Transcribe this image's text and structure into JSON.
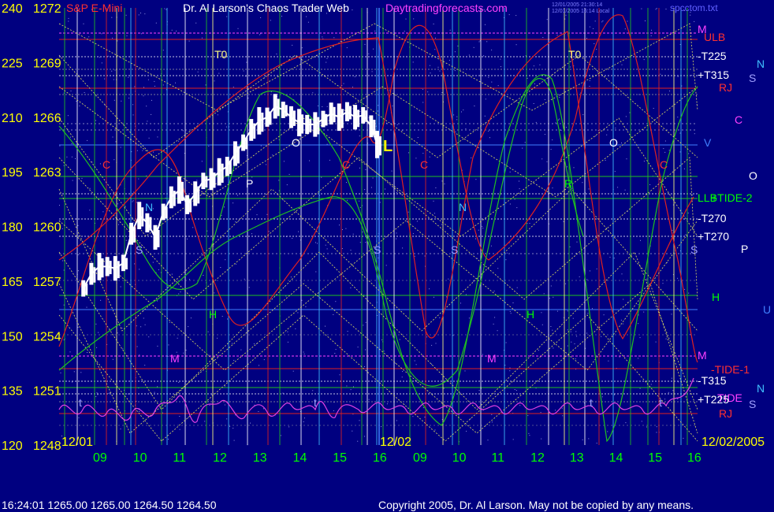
{
  "header": {
    "symbol": "S&P E-Mini",
    "title": "Dr. Al Larson's Chaos Trader Web",
    "site": "Daytradingforecasts.com",
    "stamp_line1": "12/01/2005 21:30:14",
    "stamp_line2": "12/01/2005 16:14 Local",
    "file": "spcctom.txt"
  },
  "footer": {
    "quote": "16:24:01  1265.00  1265.00  1264.50  1264.50",
    "copyright": "Copyright 2005, Dr. Al Larson. May not be copied by any means."
  },
  "left_axis": [
    {
      "deg": "240",
      "price": "1272"
    },
    {
      "deg": "225",
      "price": "1269"
    },
    {
      "deg": "210",
      "price": "1266"
    },
    {
      "deg": "195",
      "price": "1263"
    },
    {
      "deg": "180",
      "price": "1260"
    },
    {
      "deg": "165",
      "price": "1257"
    },
    {
      "deg": "150",
      "price": "1254"
    },
    {
      "deg": "135",
      "price": "1251"
    },
    {
      "deg": "120",
      "price": "1248"
    }
  ],
  "x_axis": {
    "day1_label": "12/01",
    "day2_label": "12/02",
    "end_label": "12/02/2005",
    "hours_day1": [
      "09",
      "10",
      "11",
      "12",
      "13",
      "14",
      "15",
      "16"
    ],
    "hours_day2": [
      "09",
      "10",
      "11",
      "12",
      "13",
      "14",
      "15",
      "16"
    ]
  },
  "right_labels": [
    {
      "text": "M",
      "color": "#ff40ff"
    },
    {
      "text": "ULB",
      "color": "#ff3030"
    },
    {
      "text": "-T225",
      "color": "#ffffff"
    },
    {
      "text": "N",
      "color": "#40c0ff"
    },
    {
      "text": "+T315",
      "color": "#ffffff"
    },
    {
      "text": "S",
      "color": "#a0a0ff"
    },
    {
      "text": "RJ",
      "color": "#ff3030"
    },
    {
      "text": "C",
      "color": "#ff40ff"
    },
    {
      "text": "V",
      "color": "#4080ff"
    },
    {
      "text": "O",
      "color": "#ffffff"
    },
    {
      "text": "LLB",
      "color": "#00ff00"
    },
    {
      "text": "+TIDE-2",
      "color": "#00ff00"
    },
    {
      "text": "-T270",
      "color": "#ffffff"
    },
    {
      "text": "+T270",
      "color": "#ffffff"
    },
    {
      "text": "P",
      "color": "#ffffff"
    },
    {
      "text": "H",
      "color": "#00ff00"
    },
    {
      "text": "U",
      "color": "#4080ff"
    },
    {
      "text": "M",
      "color": "#ff40ff"
    },
    {
      "text": "-TIDE-1",
      "color": "#ff3030"
    },
    {
      "text": "-T315",
      "color": "#ffffff"
    },
    {
      "text": "N",
      "color": "#40c0ff"
    },
    {
      "text": "TIDE",
      "color": "#ff40ff"
    },
    {
      "text": "+T225",
      "color": "#ffffff"
    },
    {
      "text": "S",
      "color": "#a0a0ff"
    },
    {
      "text": "RJ",
      "color": "#ff3030"
    }
  ],
  "chart_labels": [
    {
      "text": "T0",
      "color": "#ffff80"
    },
    {
      "text": "T0",
      "color": "#ffff80"
    },
    {
      "text": "C",
      "color": "#ff3030"
    },
    {
      "text": "N",
      "color": "#40c0ff"
    },
    {
      "text": "S",
      "color": "#a0a0ff"
    },
    {
      "text": "P",
      "color": "#ffffff"
    },
    {
      "text": "H",
      "color": "#00ff00"
    },
    {
      "text": "M",
      "color": "#ff40ff"
    },
    {
      "text": "O",
      "color": "#ffffff"
    },
    {
      "text": "C",
      "color": "#ff3030"
    },
    {
      "text": "S",
      "color": "#a0a0ff"
    },
    {
      "text": "L",
      "color": "#ffff00"
    },
    {
      "text": "C",
      "color": "#ff3030"
    },
    {
      "text": "N",
      "color": "#40c0ff"
    },
    {
      "text": "S",
      "color": "#a0a0ff"
    },
    {
      "text": "H",
      "color": "#00ff00"
    },
    {
      "text": "M",
      "color": "#ff40ff"
    },
    {
      "text": "R",
      "color": "#00ff00"
    },
    {
      "text": "O",
      "color": "#ffffff"
    },
    {
      "text": "C",
      "color": "#ff3030"
    },
    {
      "text": "S",
      "color": "#a0a0ff"
    },
    {
      "text": "t",
      "color": "#a0a0ff"
    },
    {
      "text": "t",
      "color": "#a0a0ff"
    },
    {
      "text": "t",
      "color": "#a0a0ff"
    },
    {
      "text": "t",
      "color": "#a0a0ff"
    }
  ],
  "colors": {
    "background": "#000080",
    "price_bars": "#ffffff",
    "axis_text": "#ffff00",
    "hour_text": "#00ff00",
    "title_text": "#ffffff",
    "site_text": "#ff40ff"
  },
  "chart_data": {
    "type": "line",
    "ylim": [
      1248,
      1272
    ],
    "price_series_x_hours": [
      8.6,
      8.8,
      9.0,
      9.2,
      9.4,
      9.6,
      9.8,
      10.0,
      10.2,
      10.4,
      10.6,
      10.8,
      11.0,
      11.2,
      11.4,
      11.6,
      11.8,
      12.0,
      12.2,
      12.4,
      12.6,
      12.8,
      13.0,
      13.2,
      13.4,
      13.6,
      13.8,
      14.0,
      14.2,
      14.4,
      14.6,
      14.8,
      15.0,
      15.2,
      15.4,
      15.6,
      15.8,
      15.95
    ],
    "price_series_close": [
      1256.6,
      1257.4,
      1257.8,
      1257.8,
      1257.7,
      1258.0,
      1259.6,
      1260.6,
      1260.2,
      1259.4,
      1260.8,
      1261.6,
      1262.0,
      1261.2,
      1261.8,
      1262.5,
      1262.6,
      1263.0,
      1263.3,
      1264.0,
      1264.6,
      1265.3,
      1265.8,
      1266.0,
      1266.6,
      1266.4,
      1266.0,
      1265.7,
      1265.6,
      1265.6,
      1265.9,
      1266.2,
      1266.0,
      1266.3,
      1266.0,
      1266.1,
      1265.5,
      1264.5
    ]
  }
}
